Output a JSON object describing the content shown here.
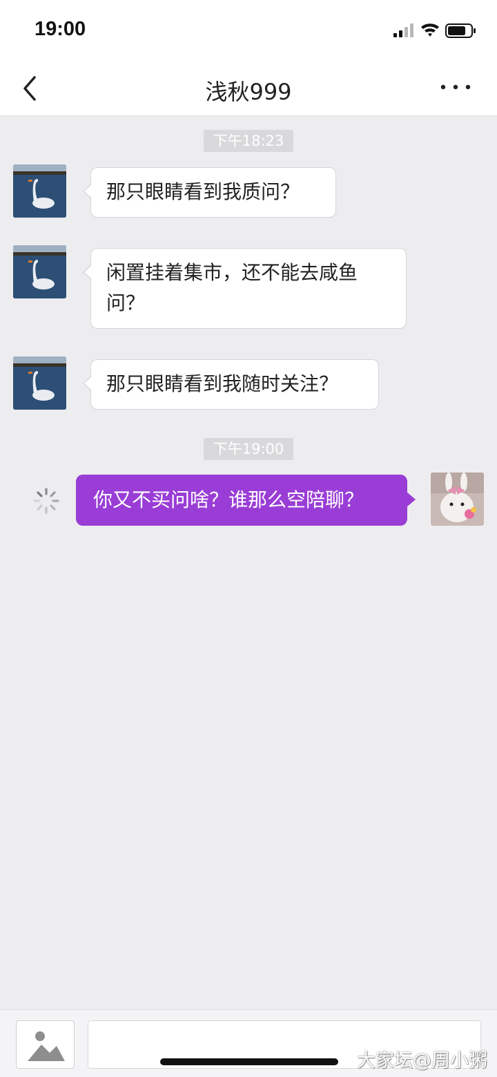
{
  "status_bar": {
    "time": "19:00"
  },
  "nav": {
    "title": "浅秋999"
  },
  "messages": [
    {
      "type": "timestamp",
      "text": "下午18:23"
    },
    {
      "type": "incoming",
      "text": "那只眼睛看到我质问？"
    },
    {
      "type": "incoming",
      "text": "闲置挂着集市，还不能去咸鱼问？"
    },
    {
      "type": "incoming",
      "text": "那只眼睛看到我随时关注？"
    },
    {
      "type": "timestamp",
      "text": "下午19:00"
    },
    {
      "type": "outgoing",
      "text": "你又不买问啥？谁那么空陪聊？",
      "status": "sending"
    }
  ],
  "input": {
    "placeholder": ""
  },
  "watermark": "大家坛@周小粥",
  "colors": {
    "outgoing_bubble": "#9a3dd6",
    "background": "#ededf0"
  }
}
